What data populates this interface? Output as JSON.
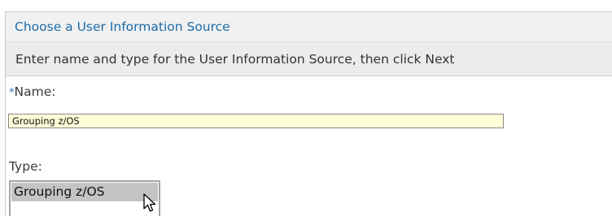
{
  "header": {
    "title": "Choose a User Information Source"
  },
  "instruction": {
    "text": "Enter name and type for the User Information Source, then click Next"
  },
  "form": {
    "name": {
      "required_marker": "*",
      "label": "Name:",
      "value": "Grouping z/OS"
    },
    "type": {
      "label": "Type:",
      "options": [
        "Grouping z/OS"
      ],
      "selected": "Grouping z/OS"
    }
  },
  "icons": {
    "cursor": "mouse-pointer-icon"
  },
  "colors": {
    "title": "#1c6ba8",
    "header_bg": "#f1f1f1",
    "instruction_bg": "#ececec",
    "input_bg": "#ffffd8",
    "selected_option_bg": "#c4c4c4",
    "required_marker": "#2a77b5"
  }
}
